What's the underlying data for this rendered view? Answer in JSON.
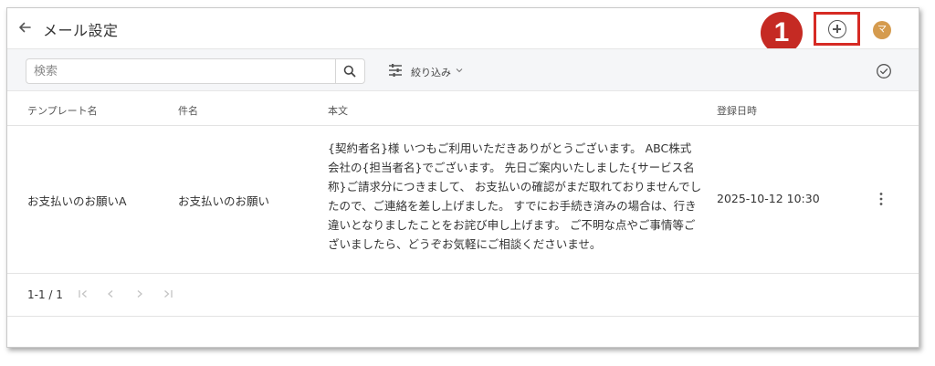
{
  "header": {
    "title": "メール設定",
    "step_number": "1",
    "avatar_initial": "マ"
  },
  "toolbar": {
    "search_placeholder": "検索",
    "filter_label": "絞り込み"
  },
  "table": {
    "columns": [
      "テンプレート名",
      "件名",
      "本文",
      "登録日時"
    ],
    "rows": [
      {
        "template_name": "お支払いのお願いA",
        "subject": "お支払いのお願い",
        "body": "{契約者名}様 いつもご利用いただきありがとうございます。 ABC株式会社の{担当者名}でございます。 先日ご案内いたしました{サービス名称}ご請求分につきまして、 お支払いの確認がまだ取れておりませんでしたので、ご連絡を差し上げました。 すでにお手続き済みの場合は、行き違いとなりましたことをお詫び申し上げます。 ご不明な点やご事情等ございましたら、どうぞお気軽にご相談くださいませ。",
        "registered_at": "2025-10-12 10:30"
      }
    ]
  },
  "pagination": {
    "range": "1-1 / 1"
  },
  "colors": {
    "accent_red": "#c52a23",
    "avatar": "#d59b4e",
    "toolbar_bg": "#f5f6f8"
  },
  "icons": [
    "back-arrow-icon",
    "add-circle-icon",
    "search-icon",
    "filter-sliders-icon",
    "chevron-down-icon",
    "check-circle-icon",
    "kebab-menu-icon",
    "first-page-icon",
    "prev-page-icon",
    "next-page-icon",
    "last-page-icon"
  ]
}
